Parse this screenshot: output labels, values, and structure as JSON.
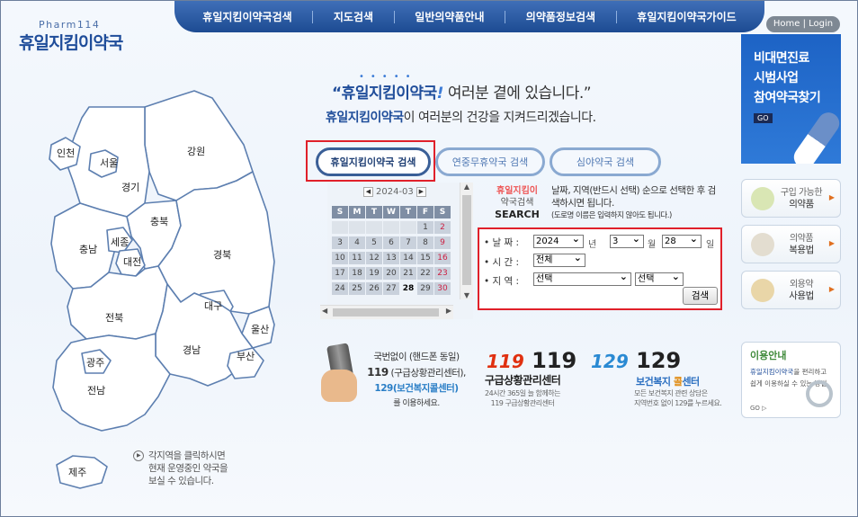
{
  "header": {
    "logo_sub": "Pharm114",
    "logo": "휴일지킴이약국",
    "nav": [
      "휴일지킴이약국검색",
      "지도검색",
      "일반의약품안내",
      "의약품정보검색",
      "휴일지킴이약국가이드"
    ],
    "home_login": "Home | Login"
  },
  "slogan": {
    "line1_brand": "“휴일지킴이약국",
    "line1_mark": "!",
    "line1_rest": " 여러분 곁에 있습니다.”",
    "line2_brand": "휴일지킴이약국",
    "line2_rest": "이 여러분의 건강을 지켜드리겠습니다."
  },
  "tabs": [
    "휴일지킴이약국 검색",
    "연중무휴약국 검색",
    "심야약국 검색"
  ],
  "calendar": {
    "month": "2024-03",
    "days_header": [
      "S",
      "M",
      "T",
      "W",
      "T",
      "F",
      "S"
    ],
    "rows": [
      [
        "",
        "",
        "",
        "",
        "",
        "1",
        "2"
      ],
      [
        "3",
        "4",
        "5",
        "6",
        "7",
        "8",
        "9"
      ],
      [
        "10",
        "11",
        "12",
        "13",
        "14",
        "15",
        "16"
      ],
      [
        "17",
        "18",
        "19",
        "20",
        "21",
        "22",
        "23"
      ],
      [
        "24",
        "25",
        "26",
        "27",
        "28",
        "29",
        "30"
      ]
    ],
    "today": "28"
  },
  "search": {
    "title1": "휴일지킴이",
    "title2": "약국검색",
    "title3": "SEARCH",
    "desc": "날짜, 지역(반드시 선택) 순으로 선택한 후 검색하시면 됩니다.",
    "note": "(도로명 이름은 입력하지 않아도 됩니다.)",
    "date_label": "• 날 짜 :",
    "year": "2024",
    "year_unit": "년",
    "month": "3",
    "month_unit": "월",
    "day": "28",
    "day_unit": "일",
    "time_label": "• 시 간 :",
    "time": "전체",
    "region_label": "• 지 역 :",
    "region1": "선택",
    "region2": "선택",
    "button": "검색"
  },
  "side": {
    "banner": "비대면진료 시범사업 참여약국찾기",
    "banner_lines": [
      "비대면진료",
      "시범사업",
      "참여약국찾기"
    ],
    "banner_go": "GO",
    "btn1_a": "구입 가능한",
    "btn1_b": "의약품",
    "btn2_a": "의약품",
    "btn2_b": "복용법",
    "btn3_a": "외용약",
    "btn3_b": "사용법",
    "info_title": "이용안내",
    "info_brand": "휴일지킴이약국",
    "info_desc": "을 편리하고 쉽게 이용하실 수 있는 방법",
    "info_go": "GO ▷"
  },
  "emergency": {
    "l1": "국번없이 (핸드폰 동일)",
    "l2a": "119",
    "l2b": " (구급상황관리센터),",
    "l3a": "129",
    "l3b": "(보건복지콜센터)",
    "l4": "를 이용하세요.",
    "n119": "119",
    "t119": "구급상황관리센터",
    "d119a": "24시간 365일 늘 함께하는",
    "d119b": "119 구급상황관리센터",
    "n129": "129",
    "t129a": "보건복지 ",
    "t129b": "콜",
    "t129c": "센터",
    "d129a": "모든 보건복지 관련 상담은",
    "d129b": "지역번호 없이 129를 누르세요."
  },
  "map": {
    "regions": [
      "인천",
      "서울",
      "경기",
      "강원",
      "충북",
      "세종",
      "충남",
      "대전",
      "경북",
      "대구",
      "전북",
      "울산",
      "경남",
      "부산",
      "광주",
      "전남",
      "제주"
    ],
    "hint": [
      "각지역을 클릭하시면",
      "현재 운영중인 약국을",
      "보실 수 있습니다."
    ]
  },
  "colors": {
    "brand": "#1f4d9a",
    "highlight_box": "#e0202a",
    "map_fill": "#ffffff",
    "map_stroke": "#4a6ea8"
  }
}
